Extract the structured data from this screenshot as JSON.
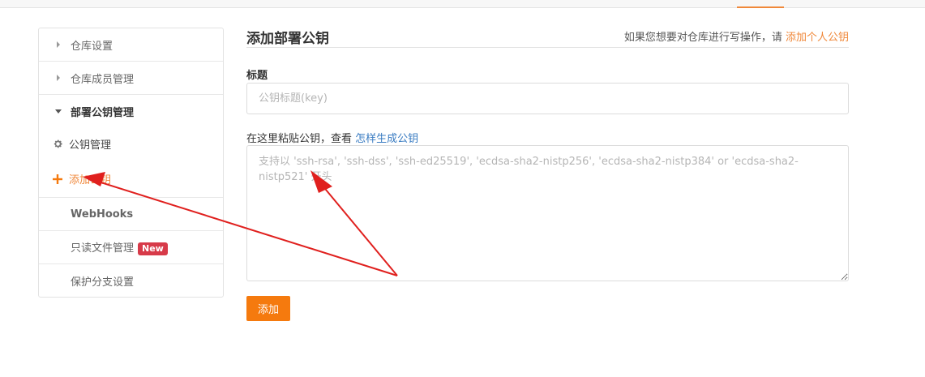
{
  "sidebar": {
    "items": [
      {
        "label": "仓库设置"
      },
      {
        "label": "仓库成员管理"
      },
      {
        "label": "部署公钥管理"
      },
      {
        "label": "公钥管理"
      },
      {
        "label": "添加公钥"
      },
      {
        "label": "WebHooks"
      },
      {
        "label": "只读文件管理",
        "badge": "New"
      },
      {
        "label": "保护分支设置"
      }
    ]
  },
  "main": {
    "title": "添加部署公钥",
    "hint_prefix": "如果您想要对仓库进行写操作，请 ",
    "hint_link": "添加个人公钥",
    "title_field": {
      "label": "标题",
      "placeholder": "公钥标题(key)",
      "value": ""
    },
    "key_field": {
      "label_prefix": "在这里粘贴公钥，查看 ",
      "label_link": "怎样生成公钥",
      "placeholder": "支持以 'ssh-rsa', 'ssh-dss', 'ssh-ed25519', 'ecdsa-sha2-nistp256', 'ecdsa-sha2-nistp384' or 'ecdsa-sha2-nistp521' 开头",
      "value": ""
    },
    "submit_label": "添加"
  },
  "colors": {
    "accent": "#f57a0e",
    "link_orange": "#f0883a",
    "link_blue": "#3a7cc2",
    "badge_red": "#d73a49",
    "annotation_red": "#e0201e"
  },
  "icons": {
    "gear": "gear-icon",
    "plus": "plus-icon",
    "caret_right": "caret-right-icon",
    "caret_down": "caret-down-icon"
  }
}
